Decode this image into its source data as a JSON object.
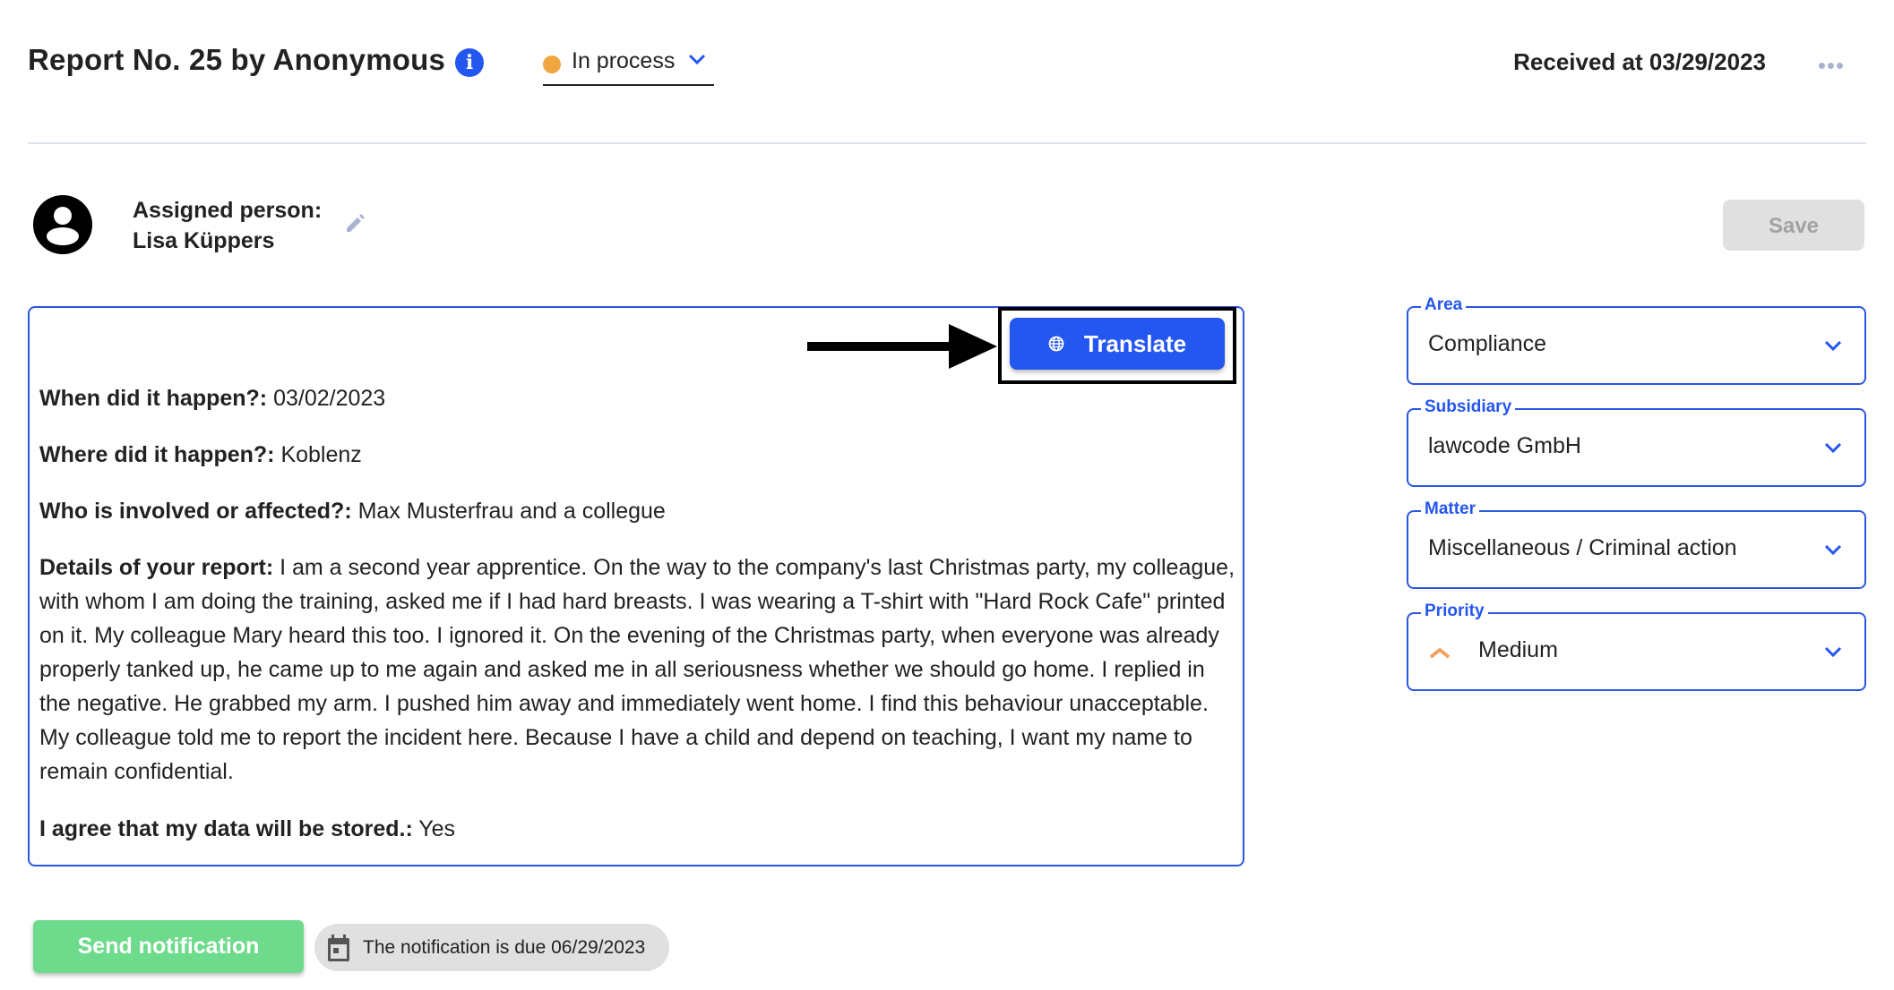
{
  "header": {
    "title": "Report No. 25 by Anonymous",
    "info_icon": "info-icon",
    "status": {
      "label": "In process",
      "dot_color": "#f0a640"
    },
    "received": "Received at 03/29/2023",
    "more_icon": "more-horizontal-icon"
  },
  "assignee": {
    "label": "Assigned person:",
    "name": "Lisa Küppers"
  },
  "toolbar": {
    "save_label": "Save"
  },
  "report": {
    "translate_label": "Translate",
    "fields": [
      {
        "label": "When did it happen?:",
        "value": " 03/02/2023"
      },
      {
        "label": "Where did it happen?:",
        "value": " Koblenz"
      },
      {
        "label": "Who is involved or affected?:",
        "value": " Max Musterfrau and a collegue"
      },
      {
        "label": "Details of your report:",
        "value": " I am a second year apprentice. On the way to the company's last Christmas party, my colleague, with whom I am doing the training, asked me if I had hard breasts. I was wearing a T-shirt with \"Hard Rock Cafe\" printed on it. My colleague Mary heard this too. I ignored it. On the evening of the Christmas party, when everyone was already properly tanked up, he came up to me again and asked me in all seriousness whether we should go home. I replied in the negative. He grabbed my arm. I pushed him away and immediately went home. I find this behaviour unacceptable. My colleague told me to report the incident here. Because I have a child and depend on teaching, I want my name to remain confidential."
      },
      {
        "label": "I agree that my data will be stored.:",
        "value": " Yes"
      }
    ]
  },
  "sidebar": {
    "dropdowns": [
      {
        "label": "Area",
        "value": "Compliance"
      },
      {
        "label": "Subsidiary",
        "value": "lawcode GmbH"
      },
      {
        "label": "Matter",
        "value": "Miscellaneous / Criminal action"
      },
      {
        "label": "Priority",
        "value": "Medium",
        "priority_color": "#f0a060"
      }
    ]
  },
  "footer": {
    "send_label": "Send notification",
    "due_text": "The notification is due 06/29/2023"
  },
  "colors": {
    "accent": "#2456f0",
    "success": "#6edb8c",
    "warning": "#f0a640"
  }
}
